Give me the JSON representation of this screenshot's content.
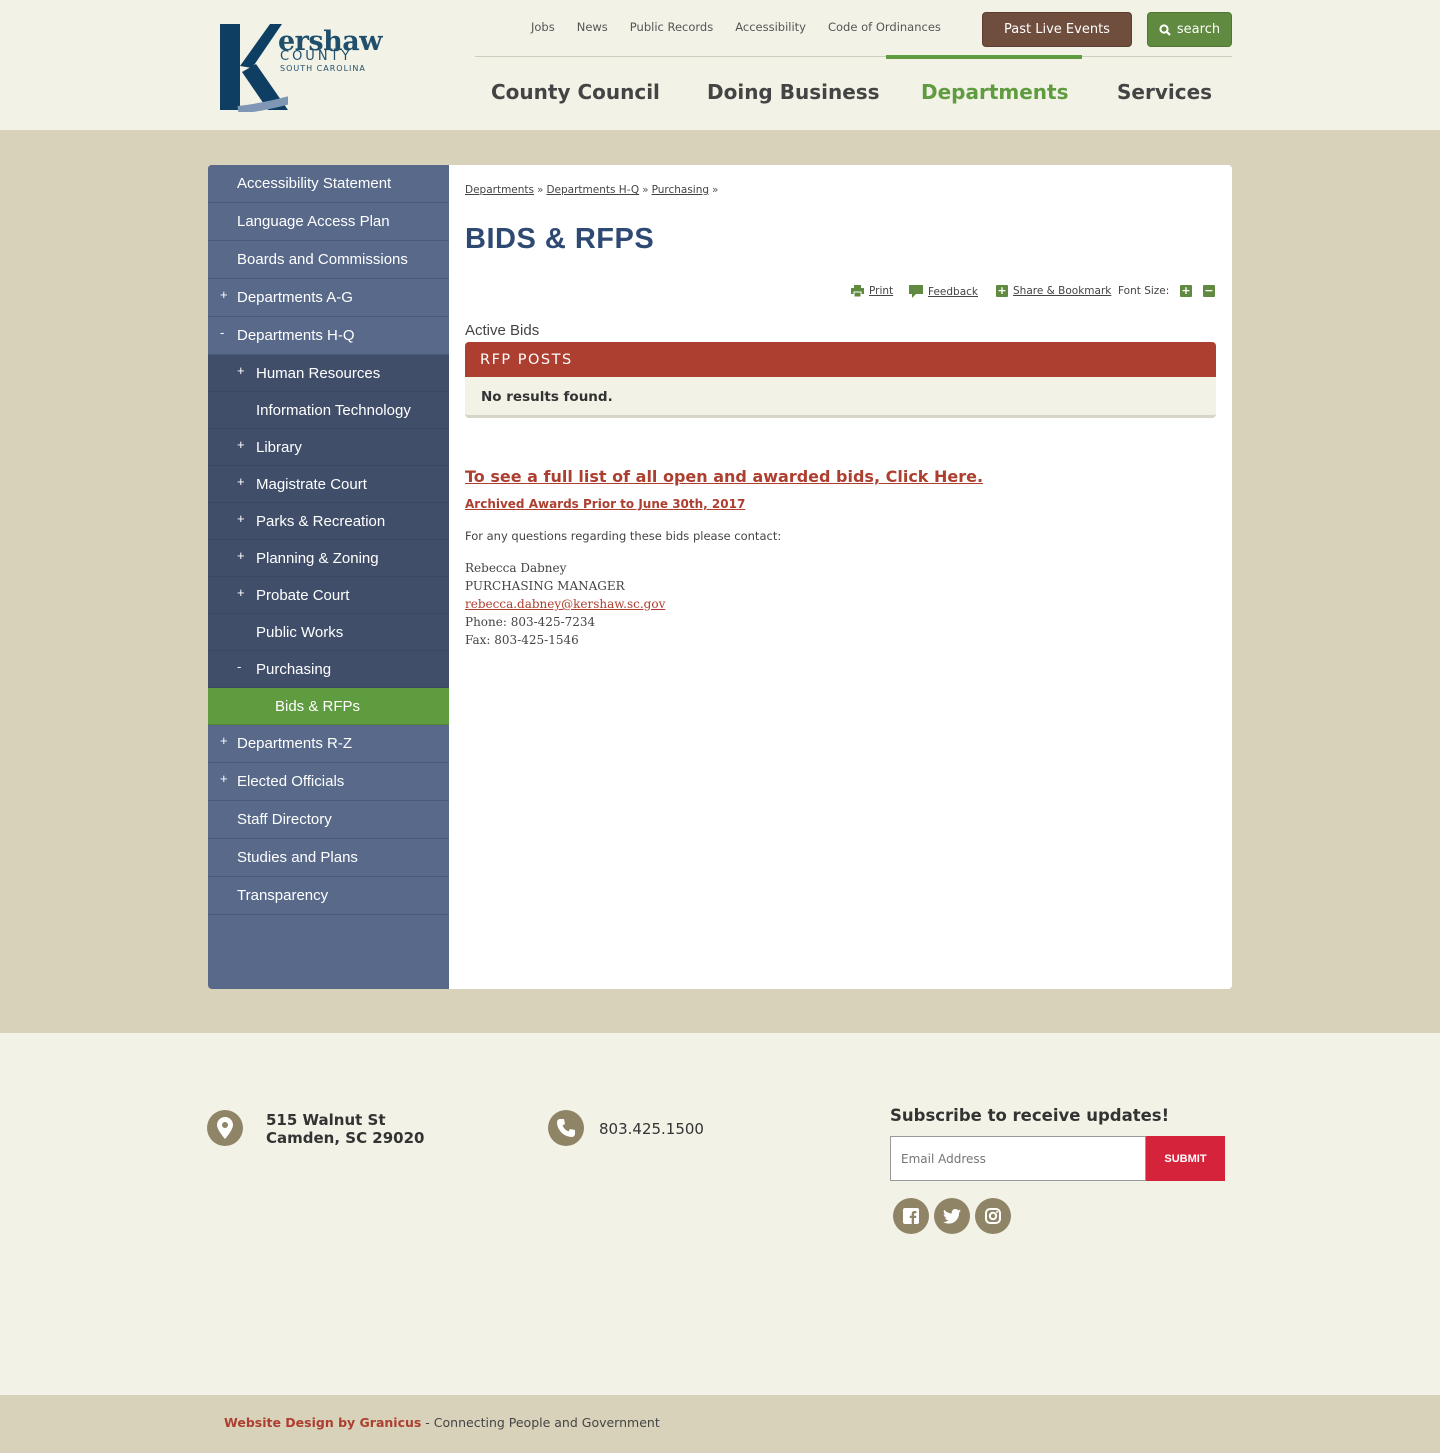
{
  "logo": {
    "brand_top": "ershaw",
    "brand_mid": "COUNTY",
    "brand_bot": "SOUTH CAROLINA",
    "colors": {
      "navy": "#0e3f63",
      "steel": "#7f97b4"
    }
  },
  "utility_nav": [
    "Jobs",
    "News",
    "Public Records",
    "Accessibility",
    "Code of Ordinances"
  ],
  "buttons": {
    "live_events": "Past Live Events",
    "search": "search"
  },
  "main_nav": [
    {
      "label": "County Council",
      "active": false
    },
    {
      "label": "Doing Business",
      "active": false
    },
    {
      "label": "Departments",
      "active": true
    },
    {
      "label": "Services",
      "active": false
    }
  ],
  "sidebar": [
    {
      "label": "Accessibility Statement",
      "level": 1,
      "toggle": ""
    },
    {
      "label": "Language Access Plan",
      "level": 1,
      "toggle": ""
    },
    {
      "label": "Boards and Commissions",
      "level": 1,
      "toggle": ""
    },
    {
      "label": "Departments A-G",
      "level": 1,
      "toggle": "+"
    },
    {
      "label": "Departments H-Q",
      "level": 1,
      "toggle": "-"
    },
    {
      "label": "Human Resources",
      "level": 2,
      "toggle": "+"
    },
    {
      "label": "Information Technology",
      "level": 2,
      "toggle": ""
    },
    {
      "label": "Library",
      "level": 2,
      "toggle": "+"
    },
    {
      "label": "Magistrate Court",
      "level": 2,
      "toggle": "+"
    },
    {
      "label": "Parks & Recreation",
      "level": 2,
      "toggle": "+"
    },
    {
      "label": "Planning & Zoning",
      "level": 2,
      "toggle": "+"
    },
    {
      "label": "Probate Court",
      "level": 2,
      "toggle": "+"
    },
    {
      "label": "Public Works",
      "level": 2,
      "toggle": ""
    },
    {
      "label": "Purchasing",
      "level": 2,
      "toggle": "-"
    },
    {
      "label": "Bids & RFPs",
      "level": 3,
      "toggle": ""
    },
    {
      "label": "Departments R-Z",
      "level": 1,
      "toggle": "+"
    },
    {
      "label": "Elected Officials",
      "level": 1,
      "toggle": "+"
    },
    {
      "label": "Staff Directory",
      "level": 1,
      "toggle": ""
    },
    {
      "label": "Studies and Plans",
      "level": 1,
      "toggle": ""
    },
    {
      "label": "Transparency",
      "level": 1,
      "toggle": ""
    }
  ],
  "breadcrumbs": [
    "Departments",
    "Departments H-Q",
    "Purchasing"
  ],
  "breadcrumb_sep": "»",
  "page_title": "BIDS & RFPS",
  "tools": {
    "print": "Print",
    "feedback": "Feedback",
    "share": "Share & Bookmark",
    "font_size": "Font Size:",
    "plus": "+",
    "minus": "−"
  },
  "active_bids_label": "Active Bids",
  "rfp": {
    "header": "RFP POSTS",
    "empty": "No results found."
  },
  "links": {
    "full_list": "To see a full list of all open and awarded bids, Click Here.",
    "archived": "Archived Awards Prior to June 30th, 2017"
  },
  "questions": "For any questions regarding these bids please contact:",
  "contact": {
    "name": "Rebecca Dabney",
    "title": "PURCHASING MANAGER",
    "email": "rebecca.dabney@kershaw.sc.gov",
    "phone": "Phone: 803-425-7234",
    "fax": "Fax: 803-425-1546"
  },
  "footer": {
    "address_line1": "515 Walnut St",
    "address_line2": "Camden, SC 29020",
    "phone": "803.425.1500",
    "subscribe_title": "Subscribe to receive updates!",
    "email_placeholder": "Email Address",
    "submit": "SUBMIT",
    "social": [
      "facebook",
      "twitter",
      "instagram"
    ],
    "credit_brand": "Website Design by Granicus",
    "credit_rest": " - Connecting People and Government"
  },
  "colors": {
    "accent_green": "#5f9b3f",
    "rfp_red": "#ad3f30",
    "title_blue": "#2e4a73",
    "submit_red": "#d6233c"
  }
}
